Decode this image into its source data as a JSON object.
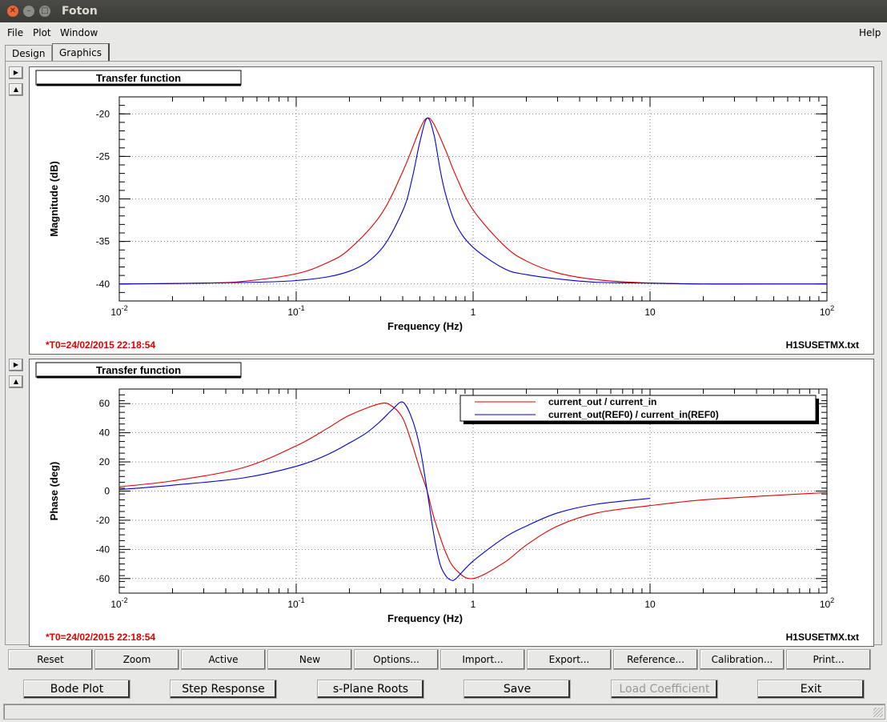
{
  "window": {
    "title": "Foton"
  },
  "menus": {
    "file": "File",
    "plot": "Plot",
    "window": "Window",
    "help": "Help"
  },
  "tabs": [
    "Design",
    "Graphics"
  ],
  "plots": [
    {
      "header": "Transfer function",
      "t0": "*T0=24/02/2015 22:18:54",
      "filename": "H1SUSETMX.txt",
      "chart_data": {
        "type": "line",
        "title": "Transfer function",
        "xlabel": "Frequency (Hz)",
        "ylabel": "Magnitude (dB)",
        "xscale": "log",
        "xlim": [
          0.01,
          100
        ],
        "ylim": [
          -42,
          -18
        ],
        "yticks": [
          -20,
          -25,
          -30,
          -35,
          -40
        ],
        "grid": true,
        "series": [
          {
            "color": "#e00000",
            "x": [
              0.01,
              0.03,
              0.05,
              0.1,
              0.15,
              0.2,
              0.3,
              0.4,
              0.5,
              0.55,
              0.6,
              0.7,
              0.8,
              1,
              1.5,
              2,
              3,
              5,
              10,
              20,
              50,
              100
            ],
            "y": [
              -40,
              -39.9,
              -39.7,
              -38.8,
              -37.5,
              -35.9,
              -31.9,
              -26.8,
              -21.8,
              -20.5,
              -21.2,
              -24.3,
              -27.3,
              -31.3,
              -35.5,
              -37.3,
              -38.7,
              -39.5,
              -39.9,
              -40,
              -40,
              -40
            ]
          },
          {
            "color": "#0000d0",
            "x": [
              0.01,
              0.03,
              0.1,
              0.2,
              0.3,
              0.4,
              0.45,
              0.5,
              0.55,
              0.6,
              0.65,
              0.7,
              0.8,
              1,
              1.5,
              2,
              3,
              5,
              10,
              20,
              50,
              100
            ],
            "y": [
              -40,
              -39.9,
              -39.6,
              -38.5,
              -36,
              -31.4,
              -27.8,
              -23.3,
              -20.5,
              -22.4,
              -26.5,
              -29.5,
              -33,
              -35.7,
              -38.2,
              -38.9,
              -39.4,
              -39.8,
              -39.9,
              -40,
              -40,
              -40
            ]
          }
        ]
      }
    },
    {
      "header": "Transfer function",
      "t0": "*T0=24/02/2015 22:18:54",
      "filename": "H1SUSETMX.txt",
      "chart_data": {
        "type": "line",
        "title": "Transfer function",
        "xlabel": "Frequency (Hz)",
        "ylabel": "Phase (deg)",
        "xscale": "log",
        "xlim": [
          0.01,
          100
        ],
        "ylim": [
          -70,
          70
        ],
        "yticks": [
          60,
          40,
          20,
          0,
          -20,
          -40,
          -60
        ],
        "grid": true,
        "legend": "top-right",
        "series": [
          {
            "name": "current_out / current_in",
            "color": "#e00000",
            "x": [
              0.01,
              0.02,
              0.05,
              0.1,
              0.15,
              0.2,
              0.3,
              0.35,
              0.4,
              0.45,
              0.5,
              0.55,
              0.6,
              0.7,
              0.8,
              1,
              1.5,
              2,
              3,
              5,
              10,
              20,
              50,
              100
            ],
            "y": [
              3,
              7,
              16,
              31,
              43,
              52,
              60,
              58,
              50,
              33,
              15,
              0,
              -18,
              -42,
              -54,
              -60,
              -49,
              -37,
              -24,
              -15,
              -10,
              -6,
              -3,
              -1
            ]
          },
          {
            "name": "current_out(REF0) / current_in(REF0)",
            "color": "#0000d0",
            "x": [
              0.01,
              0.02,
              0.05,
              0.1,
              0.15,
              0.2,
              0.25,
              0.3,
              0.35,
              0.4,
              0.45,
              0.5,
              0.55,
              0.6,
              0.65,
              0.7,
              0.75,
              0.8,
              1,
              1.5,
              2,
              3,
              5,
              10
            ],
            "y": [
              1,
              4,
              9,
              17,
              25,
              33,
              40,
              48,
              56,
              61,
              50,
              30,
              0,
              -30,
              -50,
              -58,
              -61,
              -60,
              -48,
              -32,
              -24,
              -15,
              -9,
              -5
            ]
          }
        ]
      }
    }
  ],
  "buttons_row1": [
    "Reset",
    "Zoom",
    "Active",
    "New",
    "Options...",
    "Import...",
    "Export...",
    "Reference...",
    "Calibration...",
    "Print..."
  ],
  "buttons_row2": {
    "bode": "Bode Plot",
    "step": "Step Response",
    "splane": "s-Plane Roots",
    "save": "Save",
    "load": "Load Coefficient",
    "exit": "Exit"
  }
}
